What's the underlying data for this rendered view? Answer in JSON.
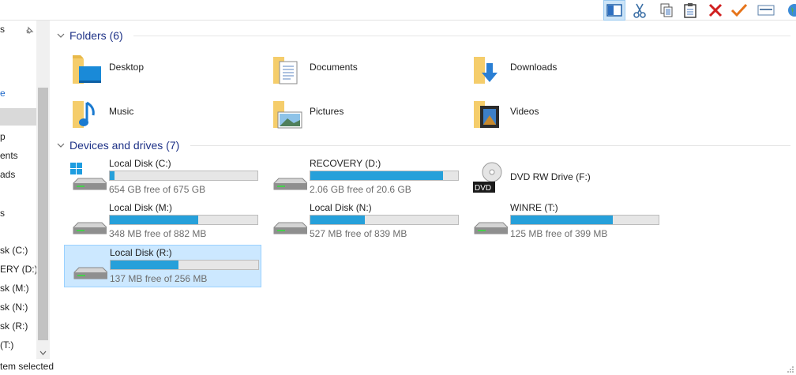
{
  "toolbar": {
    "buttons": [
      {
        "name": "details-pane-icon"
      },
      {
        "name": "cut-icon"
      },
      {
        "name": "copy-icon"
      },
      {
        "name": "paste-icon"
      },
      {
        "name": "delete-icon"
      },
      {
        "name": "check-icon"
      },
      {
        "name": "rename-icon"
      },
      {
        "name": "globe-icon"
      }
    ]
  },
  "nav": {
    "items": [
      {
        "label": "s",
        "selected": false,
        "blue": false
      },
      {
        "label": "e",
        "selected": false,
        "blue": true
      },
      {
        "label": "",
        "selected": true,
        "blue": false
      },
      {
        "label": "p",
        "selected": false,
        "blue": false
      },
      {
        "label": "ents",
        "selected": false,
        "blue": false
      },
      {
        "label": "ads",
        "selected": false,
        "blue": false
      },
      {
        "label": "s",
        "selected": false,
        "blue": false
      },
      {
        "label": "sk (C:)",
        "selected": false,
        "blue": false
      },
      {
        "label": "ERY (D:)",
        "selected": false,
        "blue": false
      },
      {
        "label": "sk (M:)",
        "selected": false,
        "blue": false
      },
      {
        "label": "sk (N:)",
        "selected": false,
        "blue": false
      },
      {
        "label": "sk (R:)",
        "selected": false,
        "blue": false
      },
      {
        "label": "(T:)",
        "selected": false,
        "blue": false
      }
    ]
  },
  "folders_group": {
    "title": "Folders (6)",
    "items": [
      {
        "name": "Desktop",
        "icon": "desktop-folder-icon"
      },
      {
        "name": "Documents",
        "icon": "documents-folder-icon"
      },
      {
        "name": "Downloads",
        "icon": "downloads-folder-icon"
      },
      {
        "name": "Music",
        "icon": "music-folder-icon"
      },
      {
        "name": "Pictures",
        "icon": "pictures-folder-icon"
      },
      {
        "name": "Videos",
        "icon": "videos-folder-icon"
      }
    ]
  },
  "drives_group": {
    "title": "Devices and drives (7)",
    "items": [
      {
        "name": "Local Disk (C:)",
        "free": "654 GB free of 675 GB",
        "used_fraction": 0.03,
        "icon": "windows-drive-icon"
      },
      {
        "name": "RECOVERY (D:)",
        "free": "2.06 GB free of 20.6 GB",
        "used_fraction": 0.9,
        "icon": "drive-icon"
      },
      {
        "name": "DVD RW Drive (F:)",
        "free": "",
        "used_fraction": null,
        "icon": "dvd-drive-icon",
        "dvd_label": "DVD"
      },
      {
        "name": "Local Disk (M:)",
        "free": "348 MB free of 882 MB",
        "used_fraction": 0.6,
        "icon": "drive-icon"
      },
      {
        "name": "Local Disk (N:)",
        "free": "527 MB free of 839 MB",
        "used_fraction": 0.37,
        "icon": "drive-icon"
      },
      {
        "name": "WINRE (T:)",
        "free": "125 MB free of 399 MB",
        "used_fraction": 0.69,
        "icon": "drive-icon"
      },
      {
        "name": "Local Disk (R:)",
        "free": "137 MB free of 256 MB",
        "used_fraction": 0.46,
        "icon": "drive-icon",
        "selected": true
      }
    ]
  },
  "status": {
    "text": "tem selected"
  },
  "colors": {
    "accent": "#26a0da",
    "group_header": "#1e3287",
    "selection": "#cce8ff"
  }
}
